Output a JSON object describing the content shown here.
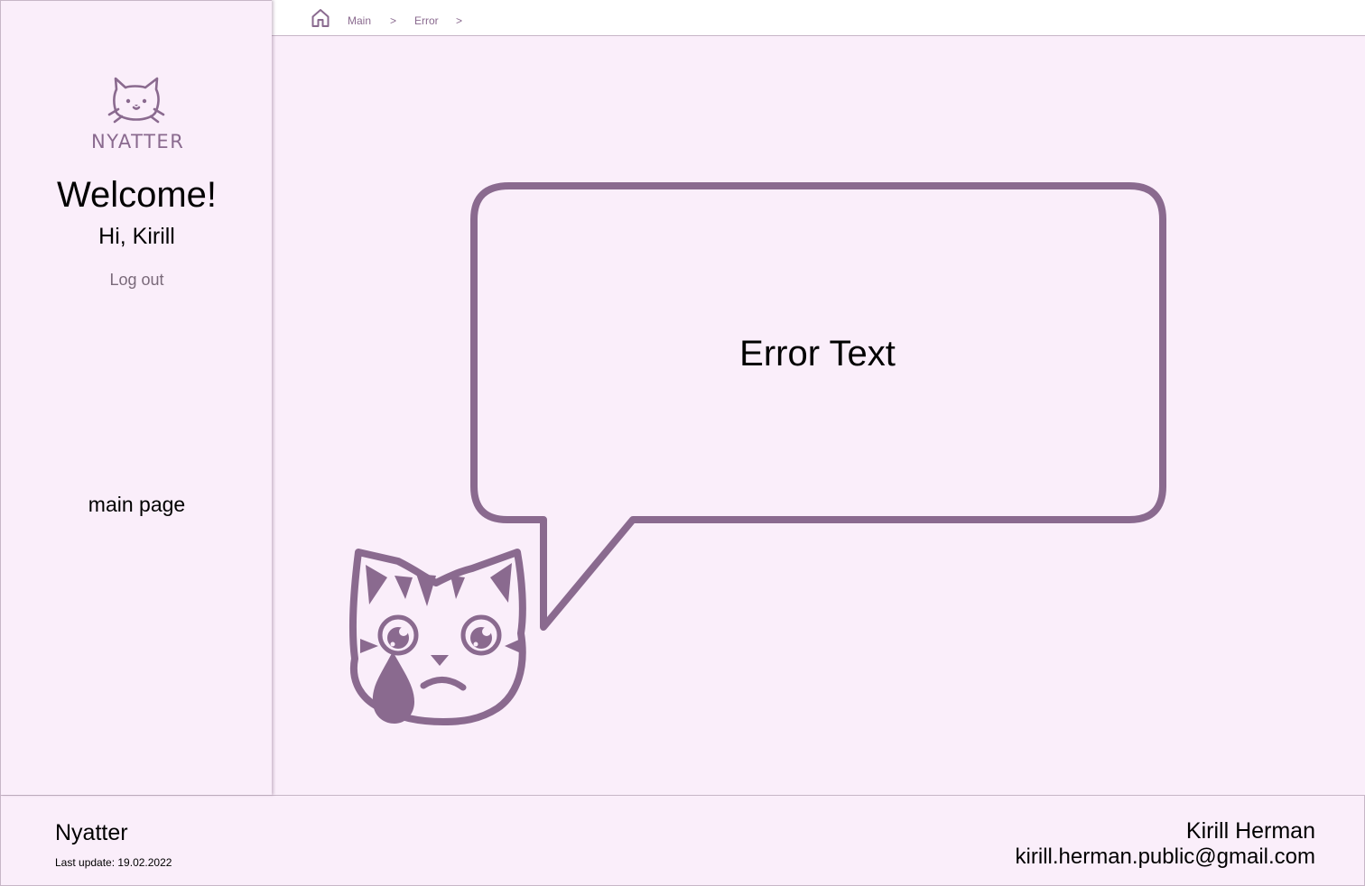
{
  "colors": {
    "accent": "#8a6a8f",
    "background": "#faeefa",
    "border": "#c7b6c7",
    "topbar": "#ffffff"
  },
  "sidebar": {
    "logo_text": "NYATTER",
    "welcome": "Welcome!",
    "greeting": "Hi, Kirill",
    "logout_label": "Log out",
    "nav_items": [
      {
        "label": "main page"
      }
    ]
  },
  "breadcrumb": {
    "home_icon": "home-icon",
    "items": [
      {
        "label": "Main"
      },
      {
        "label": ">"
      },
      {
        "label": "Error"
      },
      {
        "label": ">"
      }
    ]
  },
  "main": {
    "error_text": "Error Text",
    "illustration": "crying-cat-icon"
  },
  "footer": {
    "brand": "Nyatter",
    "last_update": "Last update: 19.02.2022",
    "author": "Kirill Herman",
    "email": "kirill.herman.public@gmail.com"
  }
}
